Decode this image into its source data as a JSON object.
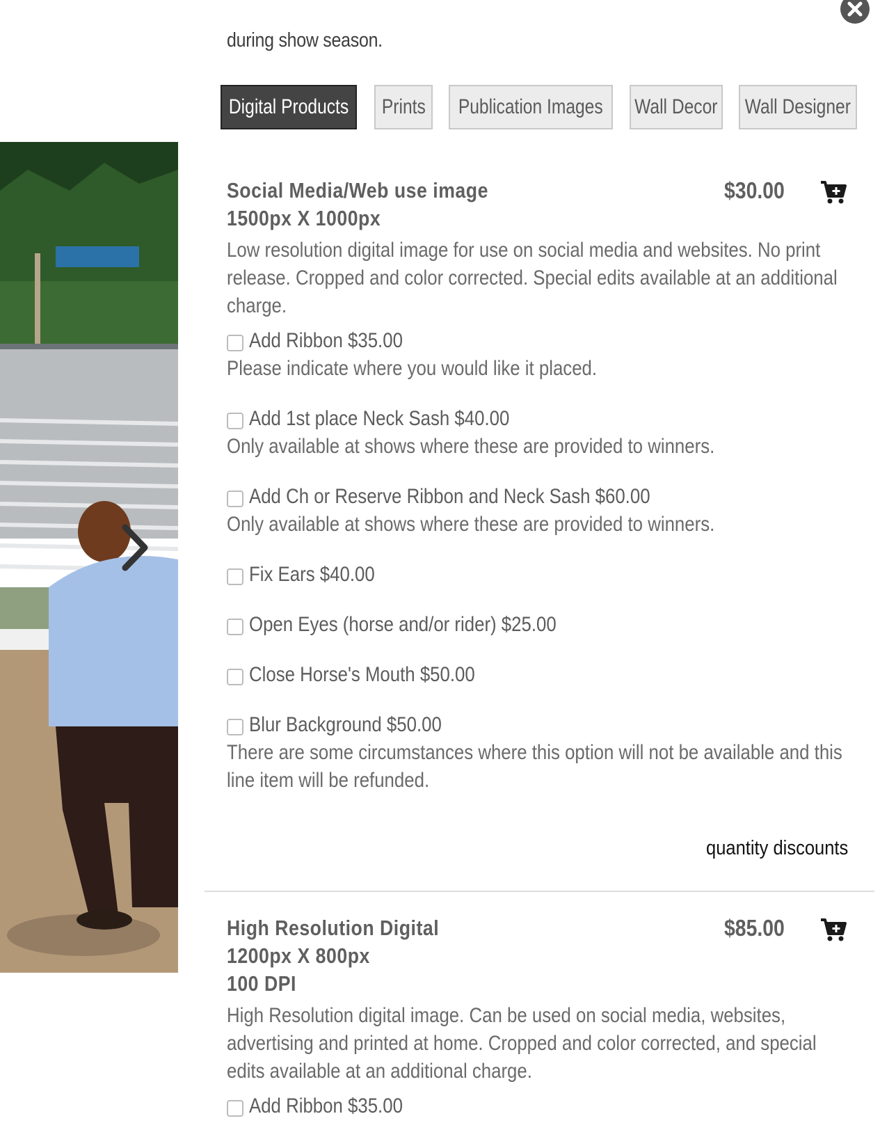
{
  "intro_text": "during show season.",
  "close_icon": "close-icon",
  "tabs": [
    {
      "label": "Digital Products",
      "active": true
    },
    {
      "label": "Prints",
      "active": false
    },
    {
      "label": "Publication Images",
      "active": false
    },
    {
      "label": "Wall Decor",
      "active": false
    },
    {
      "label": "Wall Designer",
      "active": false
    }
  ],
  "products": [
    {
      "title_line1": "Social Media/Web use image",
      "title_line2": "1500px X 1000px",
      "price": "$30.00",
      "cart_icon": "add-to-cart-icon",
      "description": "Low resolution digital image for use on social media and websites. No print release. Cropped and color corrected. Special edits available at an additional charge.",
      "options": [
        {
          "label": "Add Ribbon $35.00",
          "note": "Please indicate where you would like it placed."
        },
        {
          "label": "Add 1st place Neck Sash $40.00",
          "note": "Only available at shows where these are provided to winners."
        },
        {
          "label": "Add Ch or Reserve Ribbon and Neck Sash $60.00",
          "note": "Only available at shows where these are provided to winners."
        },
        {
          "label": "Fix Ears $40.00",
          "note": ""
        },
        {
          "label": "Open Eyes (horse and/or rider) $25.00",
          "note": ""
        },
        {
          "label": "Close Horse's Mouth $50.00",
          "note": ""
        },
        {
          "label": "Blur Background $50.00",
          "note": "There are some circumstances where this option will not be available and this line item will be refunded."
        }
      ],
      "quantity_link": "quantity discounts"
    },
    {
      "title_line1": "High Resolution Digital",
      "title_line2": "1200px X 800px",
      "title_line3": "100 DPI",
      "price": "$85.00",
      "cart_icon": "add-to-cart-icon",
      "description": "High Resolution digital image. Can be used on social media, websites, advertising and printed at home. Cropped and color corrected, and special edits available at an additional charge.",
      "options": [
        {
          "label": "Add Ribbon $35.00",
          "note": ""
        }
      ]
    }
  ],
  "photo": {
    "next_icon": "chevron-right-icon"
  }
}
